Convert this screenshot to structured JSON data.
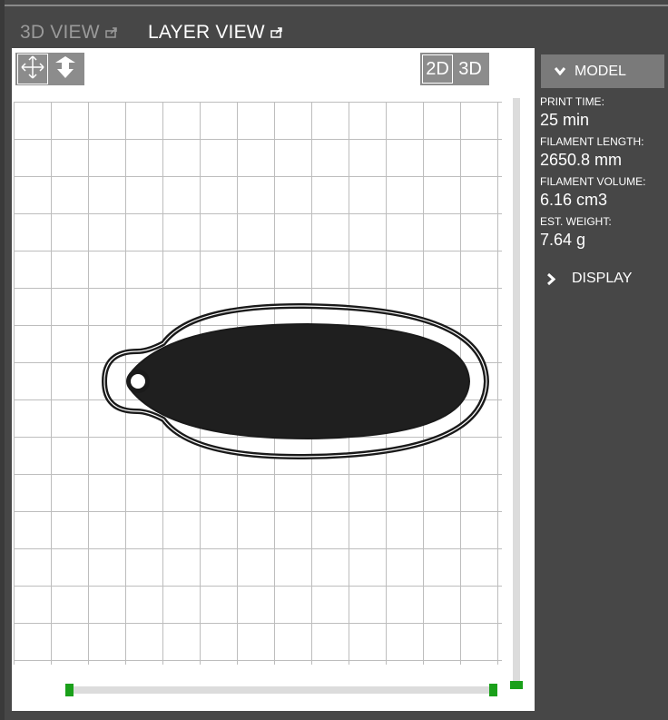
{
  "tabs": {
    "view3d": "3D VIEW",
    "layer_view": "LAYER VIEW"
  },
  "toolbar": {
    "move_icon": "move-arrows-icon",
    "drop_icon": "drop-to-bed-icon",
    "view_2d": "2D",
    "view_3d": "3D"
  },
  "panel": {
    "model_label": "MODEL",
    "stats": [
      {
        "label": "PRINT TIME:",
        "value": "25 min"
      },
      {
        "label": "FILAMENT LENGTH:",
        "value": "2650.8 mm"
      },
      {
        "label": "FILAMENT VOLUME:",
        "value": "6.16 cm3"
      },
      {
        "label": "EST. WEIGHT:",
        "value": "7.64 g"
      }
    ],
    "display_label": "DISPLAY"
  },
  "colors": {
    "background": "#474747",
    "viewport": "#ffffff",
    "grid": "#bdbdbd",
    "slider_handle": "#1aa01a",
    "slider_track": "#dcdcdc",
    "model_button": "#7a7a7a",
    "toolbar": "#8c8c8c",
    "print_path": "#1a1a1a"
  }
}
